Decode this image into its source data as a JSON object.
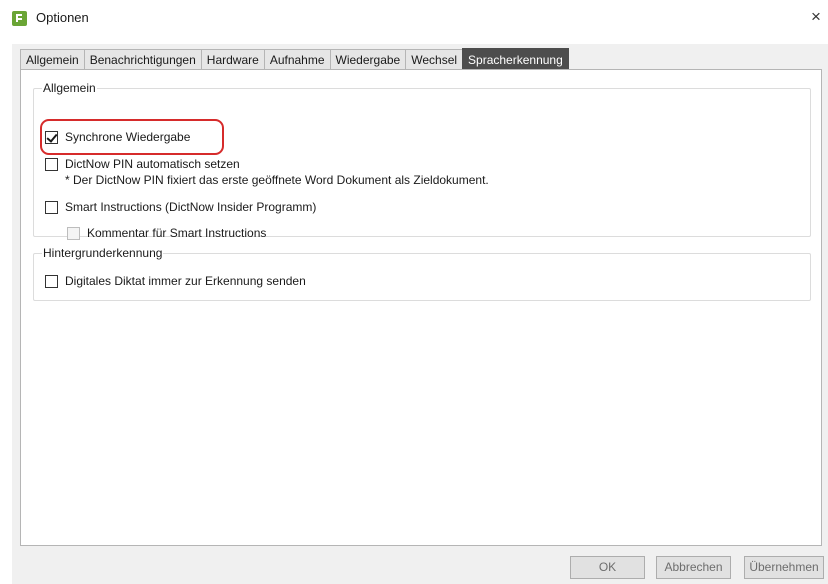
{
  "window": {
    "title": "Optionen",
    "close_symbol": "×",
    "accent": "#6aa535"
  },
  "tabs": [
    {
      "label": "Allgemein",
      "active": false
    },
    {
      "label": "Benachrichtigungen",
      "active": false
    },
    {
      "label": "Hardware",
      "active": false
    },
    {
      "label": "Aufnahme",
      "active": false
    },
    {
      "label": "Wiedergabe",
      "active": false
    },
    {
      "label": "Wechsel",
      "active": false
    },
    {
      "label": "Spracherkennung",
      "active": true
    }
  ],
  "groups": {
    "allgemein": {
      "label": "Allgemein",
      "synchrone": {
        "label": "Synchrone Wiedergabe",
        "checked": true
      },
      "dictnow_pin": {
        "label": "DictNow PIN automatisch setzen",
        "checked": false,
        "note": "* Der DictNow PIN fixiert das erste geöffnete Word Dokument als Zieldokument."
      },
      "smart_instructions": {
        "label": "Smart Instructions (DictNow Insider Programm)",
        "checked": false
      },
      "kommentar": {
        "label": "Kommentar für Smart Instructions",
        "checked": false,
        "enabled": false
      }
    },
    "hintergrund": {
      "label": "Hintergrunderkennung",
      "digitales_diktat": {
        "label": "Digitales Diktat immer zur Erkennung senden",
        "checked": false
      }
    }
  },
  "buttons": {
    "ok": "OK",
    "cancel": "Abbrechen",
    "apply": "Übernehmen"
  },
  "highlight_color": "#d62b2b"
}
